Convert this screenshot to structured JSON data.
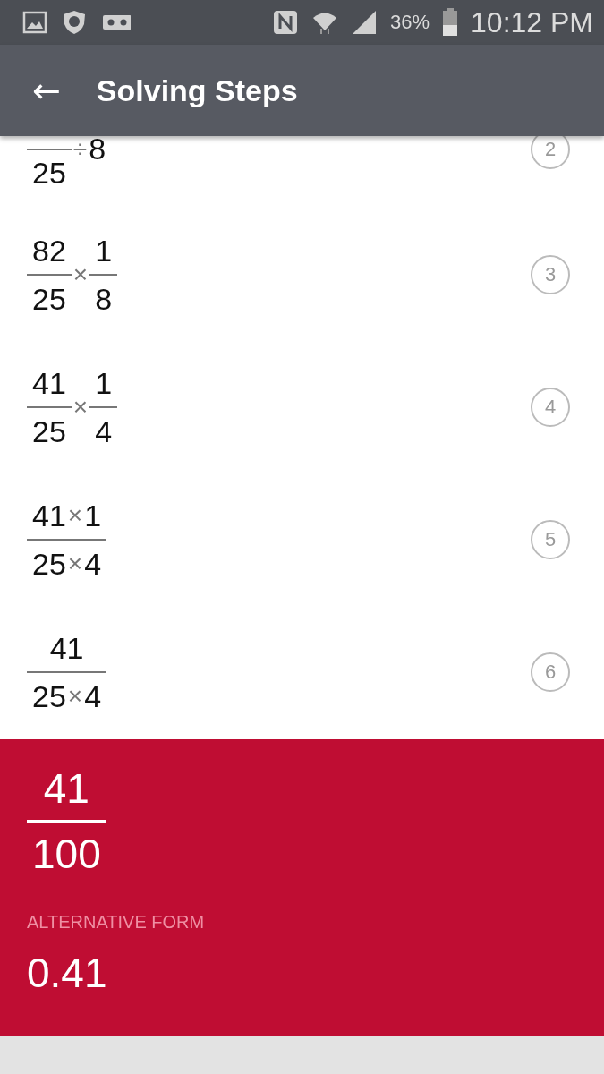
{
  "status_bar": {
    "battery_text": "36%",
    "time": "10:12 PM"
  },
  "app_bar": {
    "back": "←",
    "title": "Solving Steps"
  },
  "steps": [
    {
      "number": "2",
      "terms": [
        {
          "kind": "fraction",
          "denominator": [
            {
              "kind": "digits",
              "text": "25"
            }
          ]
        },
        {
          "kind": "operator",
          "text": "÷"
        },
        {
          "kind": "digits",
          "text": "8"
        }
      ]
    },
    {
      "number": "3",
      "terms": [
        {
          "kind": "fraction",
          "numerator": [
            {
              "kind": "digits",
              "text": "82"
            }
          ],
          "denominator": [
            {
              "kind": "digits",
              "text": "25"
            }
          ]
        },
        {
          "kind": "operator",
          "text": "×"
        },
        {
          "kind": "fraction",
          "numerator": [
            {
              "kind": "digits",
              "text": "1"
            }
          ],
          "denominator": [
            {
              "kind": "digits",
              "text": "8"
            }
          ]
        }
      ]
    },
    {
      "number": "4",
      "terms": [
        {
          "kind": "fraction",
          "numerator": [
            {
              "kind": "digits",
              "text": "41"
            }
          ],
          "denominator": [
            {
              "kind": "digits",
              "text": "25"
            }
          ]
        },
        {
          "kind": "operator",
          "text": "×"
        },
        {
          "kind": "fraction",
          "numerator": [
            {
              "kind": "digits",
              "text": "1"
            }
          ],
          "denominator": [
            {
              "kind": "digits",
              "text": "4"
            }
          ]
        }
      ]
    },
    {
      "number": "5",
      "terms": [
        {
          "kind": "fraction",
          "numerator": [
            {
              "kind": "digits",
              "text": "41"
            },
            {
              "kind": "operator",
              "text": "×"
            },
            {
              "kind": "digits",
              "text": "1"
            }
          ],
          "denominator": [
            {
              "kind": "digits",
              "text": "25"
            },
            {
              "kind": "operator",
              "text": "×"
            },
            {
              "kind": "digits",
              "text": "4"
            }
          ]
        }
      ]
    },
    {
      "number": "6",
      "terms": [
        {
          "kind": "fraction",
          "numerator": [
            {
              "kind": "digits",
              "text": "41"
            }
          ],
          "denominator": [
            {
              "kind": "digits",
              "text": "25"
            },
            {
              "kind": "operator",
              "text": "×"
            },
            {
              "kind": "digits",
              "text": "4"
            }
          ]
        }
      ]
    }
  ],
  "result": {
    "numerator": "41",
    "denominator": "100",
    "alternative_label": "ALTERNATIVE FORM",
    "alternative_value": "0.41"
  }
}
